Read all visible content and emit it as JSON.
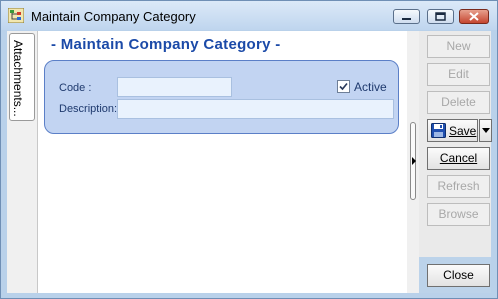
{
  "window": {
    "title": "Maintain Company Category",
    "controls": [
      "minimize",
      "maximize",
      "close"
    ]
  },
  "sidebar": {
    "attachments_tab": "Attachments..."
  },
  "form": {
    "heading": "- Maintain Company Category -",
    "code_label": "Code :",
    "code_value": "",
    "active_label": "Active",
    "active_checked": true,
    "description_label": "Description:",
    "description_value": ""
  },
  "buttons": {
    "new": "New",
    "edit": "Edit",
    "delete": "Delete",
    "save": "Save",
    "cancel": "Cancel",
    "refresh": "Refresh",
    "browse": "Browse",
    "close": "Close"
  },
  "icons": {
    "app": "category-tree-icon",
    "save": "floppy-disk-icon",
    "save_dropdown": "chevron-down-icon",
    "splitter": "chevron-right-icon"
  },
  "colors": {
    "heading": "#1b4aa8",
    "panel": "#c2d4f2",
    "panel_border": "#5b7fc7",
    "field": "#e9f2fd",
    "titlebar": "#bfd5ee",
    "close_button": "#c54630"
  }
}
